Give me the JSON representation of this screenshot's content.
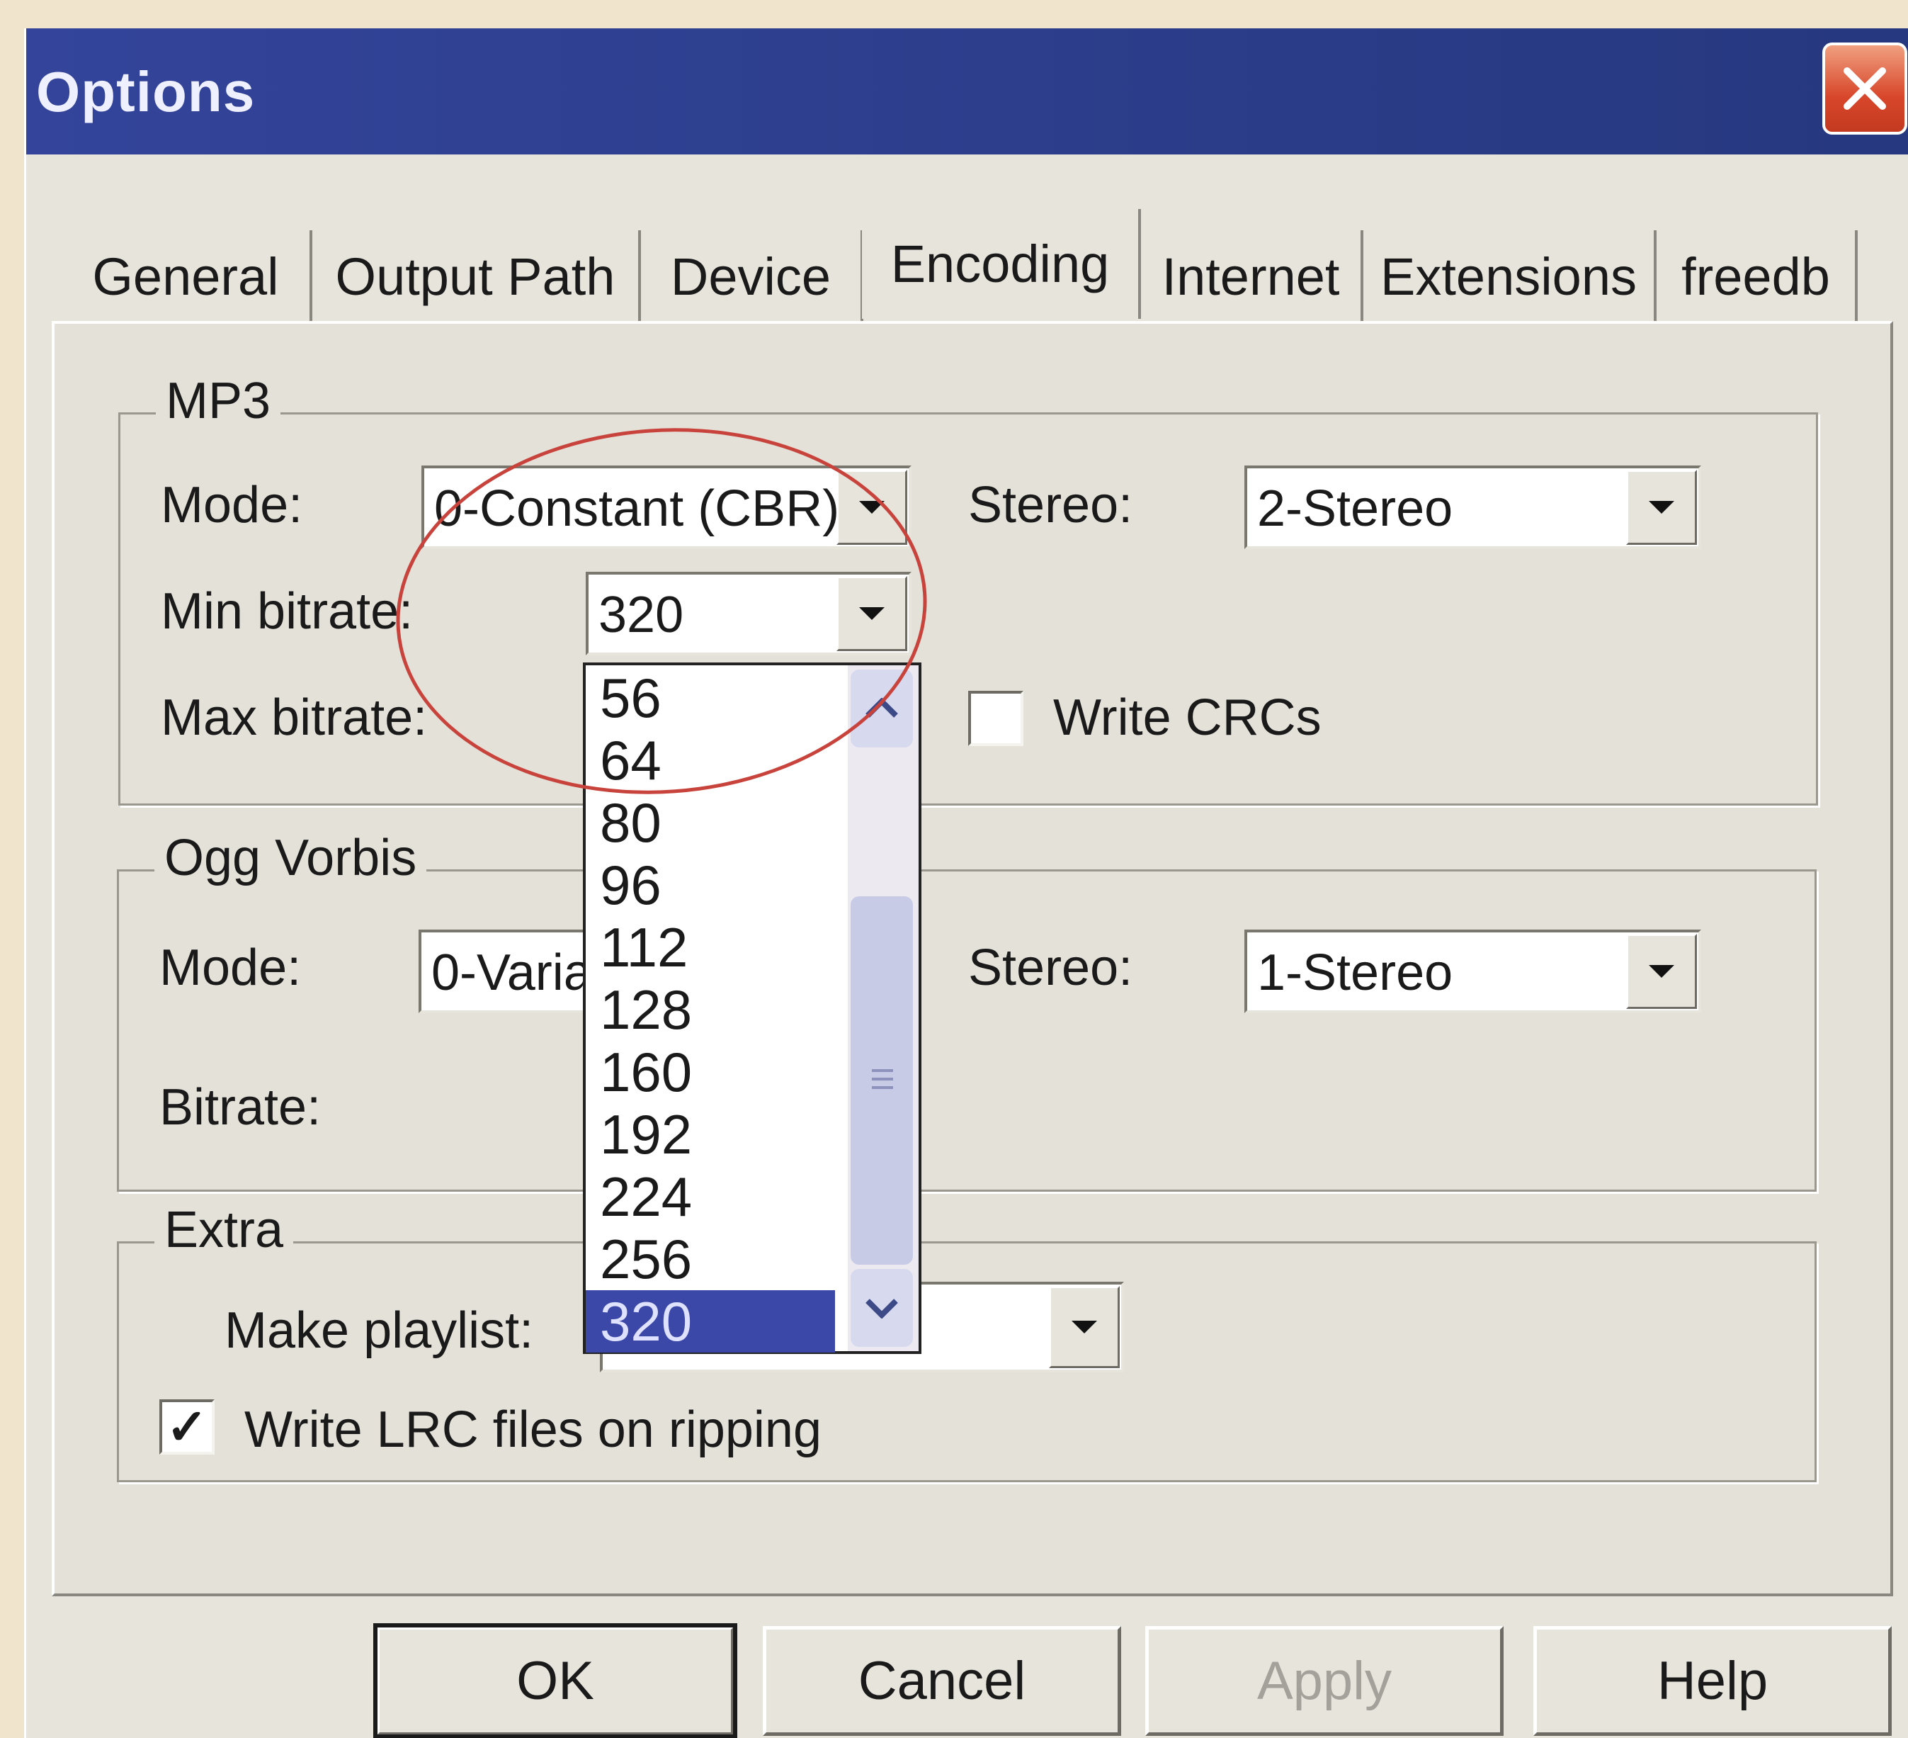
{
  "window": {
    "title": "Options"
  },
  "tabs": [
    {
      "label": "General"
    },
    {
      "label": "Output Path"
    },
    {
      "label": "Device"
    },
    {
      "label": "Encoding"
    },
    {
      "label": "Internet"
    },
    {
      "label": "Extensions"
    },
    {
      "label": "freedb"
    }
  ],
  "active_tab": "Encoding",
  "mp3": {
    "legend": "MP3",
    "mode_label": "Mode:",
    "mode_value": "0-Constant (CBR)",
    "stereo_label": "Stereo:",
    "stereo_value": "2-Stereo",
    "min_bitrate_label": "Min bitrate:",
    "min_bitrate_value": "320",
    "max_bitrate_label": "Max bitrate:",
    "write_crcs_label": "Write CRCs",
    "write_crcs_checked": false
  },
  "ogg": {
    "legend": "Ogg Vorbis",
    "mode_label": "Mode:",
    "mode_value": "0-Varia",
    "stereo_label": "Stereo:",
    "stereo_value": "1-Stereo",
    "bitrate_label": "Bitrate:"
  },
  "extra": {
    "legend": "Extra",
    "make_playlist_label": "Make playlist:",
    "write_lrc_label": "Write LRC files on ripping",
    "write_lrc_checked": true,
    "check_mark": "✓"
  },
  "bitrate_options": [
    "56",
    "64",
    "80",
    "96",
    "112",
    "128",
    "160",
    "192",
    "224",
    "256",
    "320"
  ],
  "bitrate_selected": "320",
  "buttons": {
    "ok": "OK",
    "cancel": "Cancel",
    "apply": "Apply",
    "help": "Help"
  },
  "colors": {
    "titlebar": "#2c3e8c",
    "selection": "#3b48a8",
    "annotation_ellipse": "#c8433c"
  }
}
